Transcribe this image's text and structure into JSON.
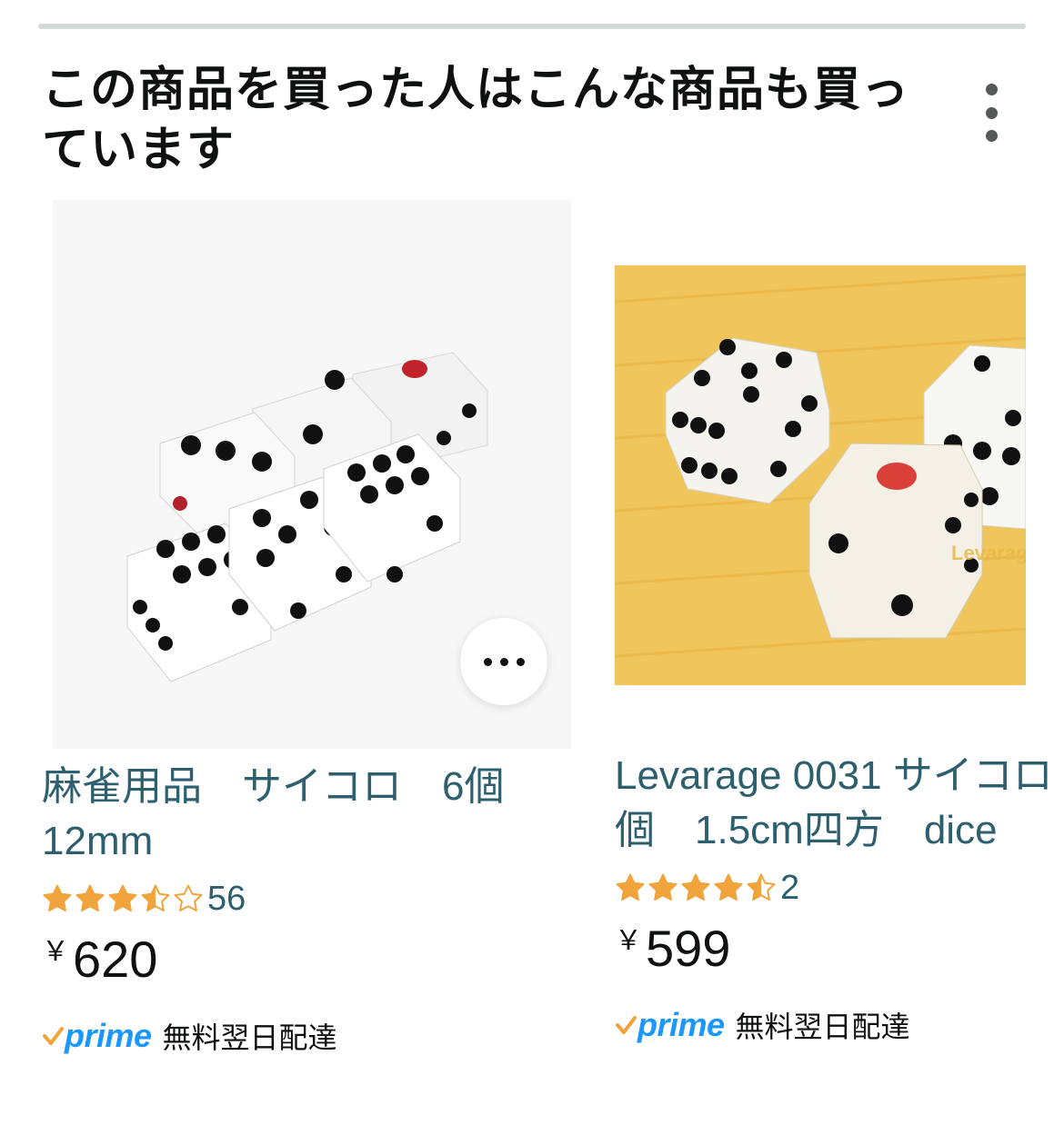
{
  "section": {
    "title": "この商品を買った人はこんな商品も買っています",
    "menu_icon": "kebab-menu-icon"
  },
  "products": [
    {
      "title": "麻雀用品　サイコロ　6個\n12mm",
      "rating": 3.5,
      "review_count": "56",
      "currency": "￥",
      "price": "620",
      "prime_label": "prime",
      "delivery": "無料翌日配達",
      "more_options_icon": "more-options-icon"
    },
    {
      "title": "Levarage 0031 サイコロ\n個　1.5cm四方　dice",
      "rating": 4.5,
      "review_count": "2",
      "currency": "￥",
      "price": "599",
      "prime_label": "prime",
      "delivery": "無料翌日配達",
      "image_watermark": "Levarage"
    }
  ],
  "colors": {
    "link": "#2d5f6f",
    "star": "#f1a33c",
    "prime_blue": "#1a98ff",
    "prime_check": "#f1a33c"
  }
}
